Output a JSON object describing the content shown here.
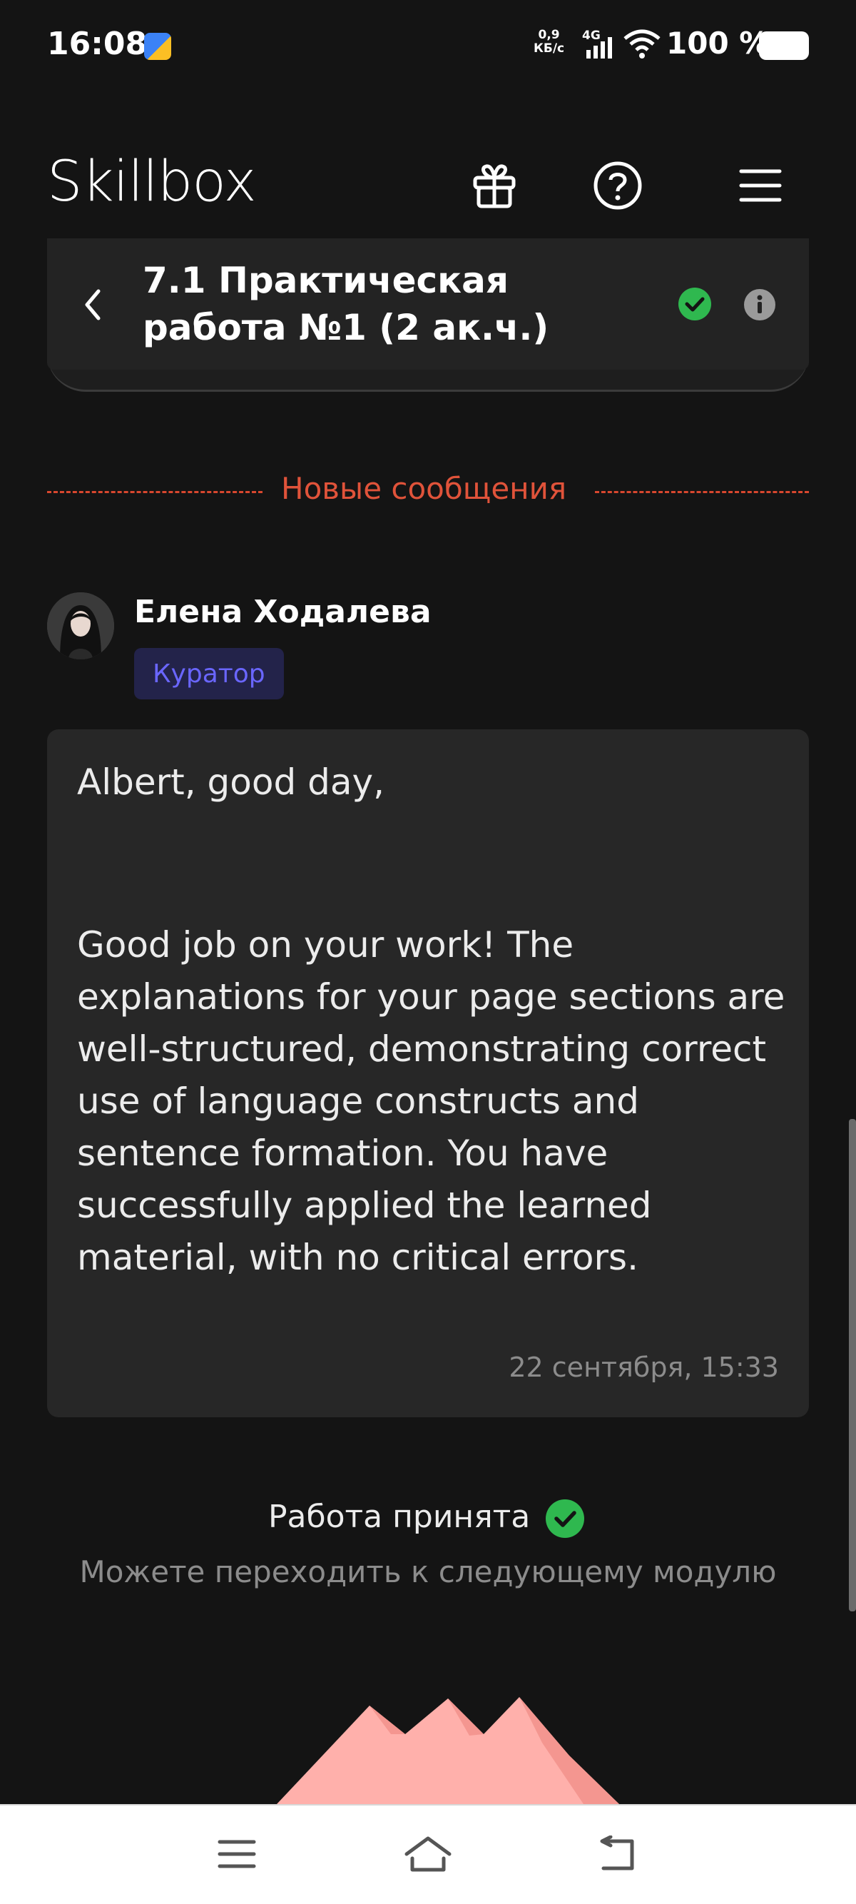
{
  "status_bar": {
    "time": "16:08",
    "net_speed_top": "0,9",
    "net_speed_bottom": "КБ/с",
    "network_type": "4G",
    "battery_percent": "100 %"
  },
  "header": {
    "logo": "Skillbox",
    "icons": [
      "gift-icon",
      "help-icon",
      "menu-icon"
    ]
  },
  "lesson": {
    "title": "7.1 Практическая работа №1 (2 ак.ч.)",
    "status_icon": "check-circle-icon",
    "info_icon": "info-icon"
  },
  "divider": {
    "label": "Новые сообщения"
  },
  "message": {
    "author": "Елена Ходалева",
    "role": "Куратор",
    "greeting": "Albert, good day,",
    "body": "Good job on your work! The explanations for your page sections are well-structured, demonstrating correct use of language constructs and sentence formation. You have successfully applied the learned material, with no critical errors.",
    "timestamp": "22 сентября, 15:33"
  },
  "result": {
    "status": "Работа принята",
    "hint": "Можете переходить к следующему модулю"
  },
  "colors": {
    "background": "#141414",
    "accent_red": "#e0533a",
    "success_green": "#2fb84f",
    "badge_bg": "#23234a",
    "badge_text": "#6a66ff",
    "mountain": "#ffb0ab"
  },
  "system_nav": {
    "icons": [
      "recent-apps-icon",
      "home-icon",
      "back-icon"
    ]
  }
}
